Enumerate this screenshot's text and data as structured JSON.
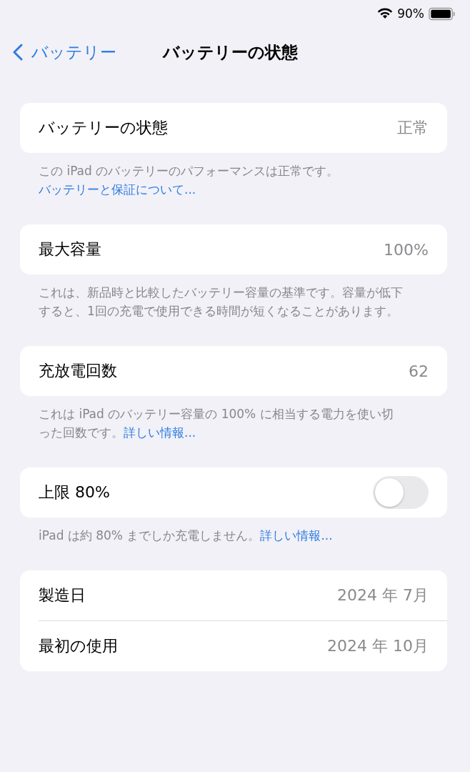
{
  "status_bar": {
    "battery": "90%"
  },
  "nav": {
    "back": "バッテリー",
    "title": "バッテリーの状態"
  },
  "sections": [
    {
      "rows": [
        {
          "kind": "value",
          "label": "バッテリーの状態",
          "value": "正常"
        }
      ],
      "footer": {
        "text": "この iPad のバッテリーのパフォーマンスは正常です。",
        "link": "バッテリーと保証について..."
      }
    },
    {
      "rows": [
        {
          "kind": "value",
          "label": "最大容量",
          "value": "100%"
        }
      ],
      "footer": {
        "text": "これは、新品時と比較したバッテリー容量の基準です。容量が低下すると、1回の充電で使用できる時間が短くなることがあります。"
      }
    },
    {
      "rows": [
        {
          "kind": "value",
          "label": "充放電回数",
          "value": "62"
        }
      ],
      "footer": {
        "text": "これは iPad のバッテリー容量の 100% に相当する電力を使い切った回数です。",
        "link": "詳しい情報..."
      }
    },
    {
      "rows": [
        {
          "kind": "toggle",
          "label": "上限 80%",
          "on": false
        }
      ],
      "footer": {
        "text": "iPad は約 80% までしか充電しません。",
        "link": "詳しい情報..."
      }
    },
    {
      "rows": [
        {
          "kind": "value",
          "label": "製造日",
          "value": "2024 年 7月"
        },
        {
          "kind": "value",
          "label": "最初の使用",
          "value": "2024 年 10月"
        }
      ]
    }
  ]
}
